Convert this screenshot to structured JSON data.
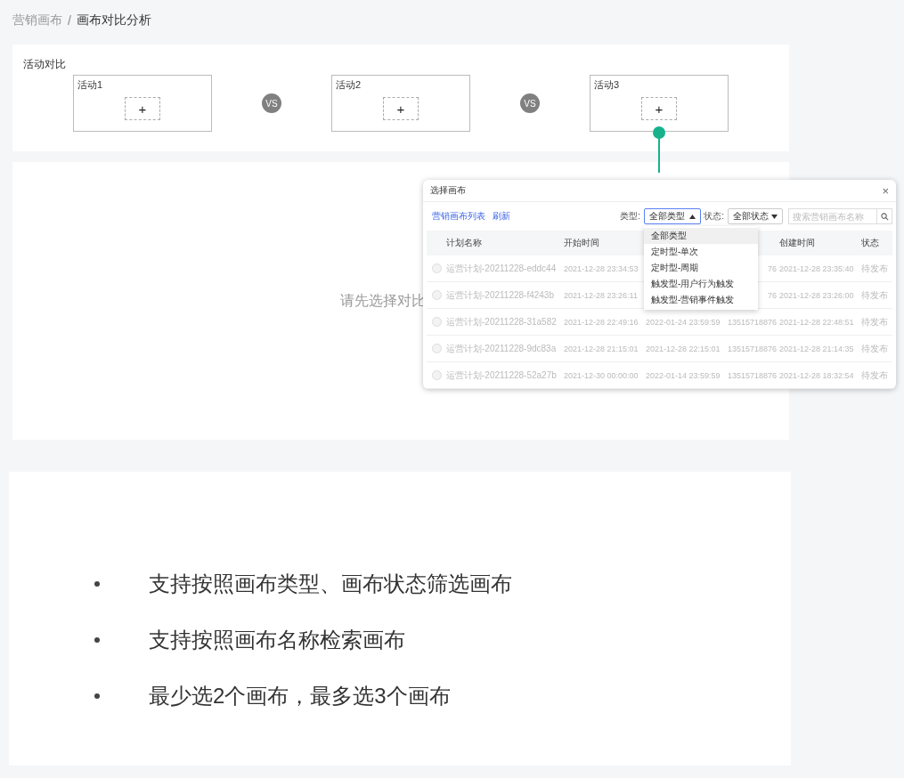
{
  "breadcrumb": [
    {
      "label": "营销画布",
      "current": false
    },
    {
      "label": "画布对比分析",
      "current": true
    }
  ],
  "breadcrumb_separator": "/",
  "compare": {
    "title": "活动对比",
    "slots": [
      {
        "label": "活动1",
        "add": "+",
        "pointed": false
      },
      {
        "label": "活动2",
        "add": "+",
        "pointed": false
      },
      {
        "label": "活动3",
        "add": "+",
        "pointed": true
      }
    ],
    "vs": [
      "VS",
      "VS"
    ]
  },
  "empty_hint": "请先选择对比",
  "dialog": {
    "title": "选择画布",
    "close": "×",
    "links": [
      "营销画布列表",
      "刷新"
    ],
    "type_filter": {
      "label": "类型:",
      "value": "全部类型",
      "expanded": true,
      "options": [
        {
          "label": "全部类型",
          "selected": true
        },
        {
          "label": "定时型-单次",
          "selected": false
        },
        {
          "label": "定时型-周期",
          "selected": false
        },
        {
          "label": "触发型-用户行为触发",
          "selected": false
        },
        {
          "label": "触发型-营销事件触发",
          "selected": false
        }
      ]
    },
    "status_filter": {
      "label": "状态:",
      "value": "全部状态",
      "expanded": false
    },
    "search": {
      "placeholder": "搜索营销画布名称"
    },
    "table": {
      "columns": [
        "计划名称",
        "开始时间",
        "创建时间",
        "状态"
      ],
      "rows": [
        {
          "selected": false,
          "name": "运营计划-20211228-eddc44",
          "start": "2021-12-28 23:34:53",
          "creator": "76",
          "created": "2021-12-28 23:35:40",
          "status": "待发布"
        },
        {
          "selected": false,
          "name": "运营计划-20211228-f4243b",
          "start": "2021-12-28 23:26:11",
          "creator": "76",
          "created": "2021-12-28 23:26:00",
          "status": "待发布"
        },
        {
          "selected": false,
          "name": "运营计划-20211228-31a582",
          "start": "2021-12-28 22:49:16",
          "end": "2022-01-24 23:59:59",
          "creator": "13515718876",
          "created": "2021-12-28 22:48:51",
          "status": "待发布"
        },
        {
          "selected": false,
          "name": "运营计划-20211228-9dc83a",
          "start": "2021-12-28 21:15:01",
          "end": "2021-12-28 22:15:01",
          "creator": "13515718876",
          "created": "2021-12-28 21:14:35",
          "status": "待发布"
        },
        {
          "selected": false,
          "name": "运营计划-20211228-52a27b",
          "start": "2021-12-30 00:00:00",
          "end": "2022-01-14 23:59:59",
          "creator": "13515718876",
          "created": "2021-12-28 18:32:54",
          "status": "待发布"
        }
      ]
    }
  },
  "bullets": [
    "支持按照画布类型、画布状态筛选画布",
    "支持按照画布名称检索画布",
    "最少选2个画布，最多选3个画布"
  ]
}
